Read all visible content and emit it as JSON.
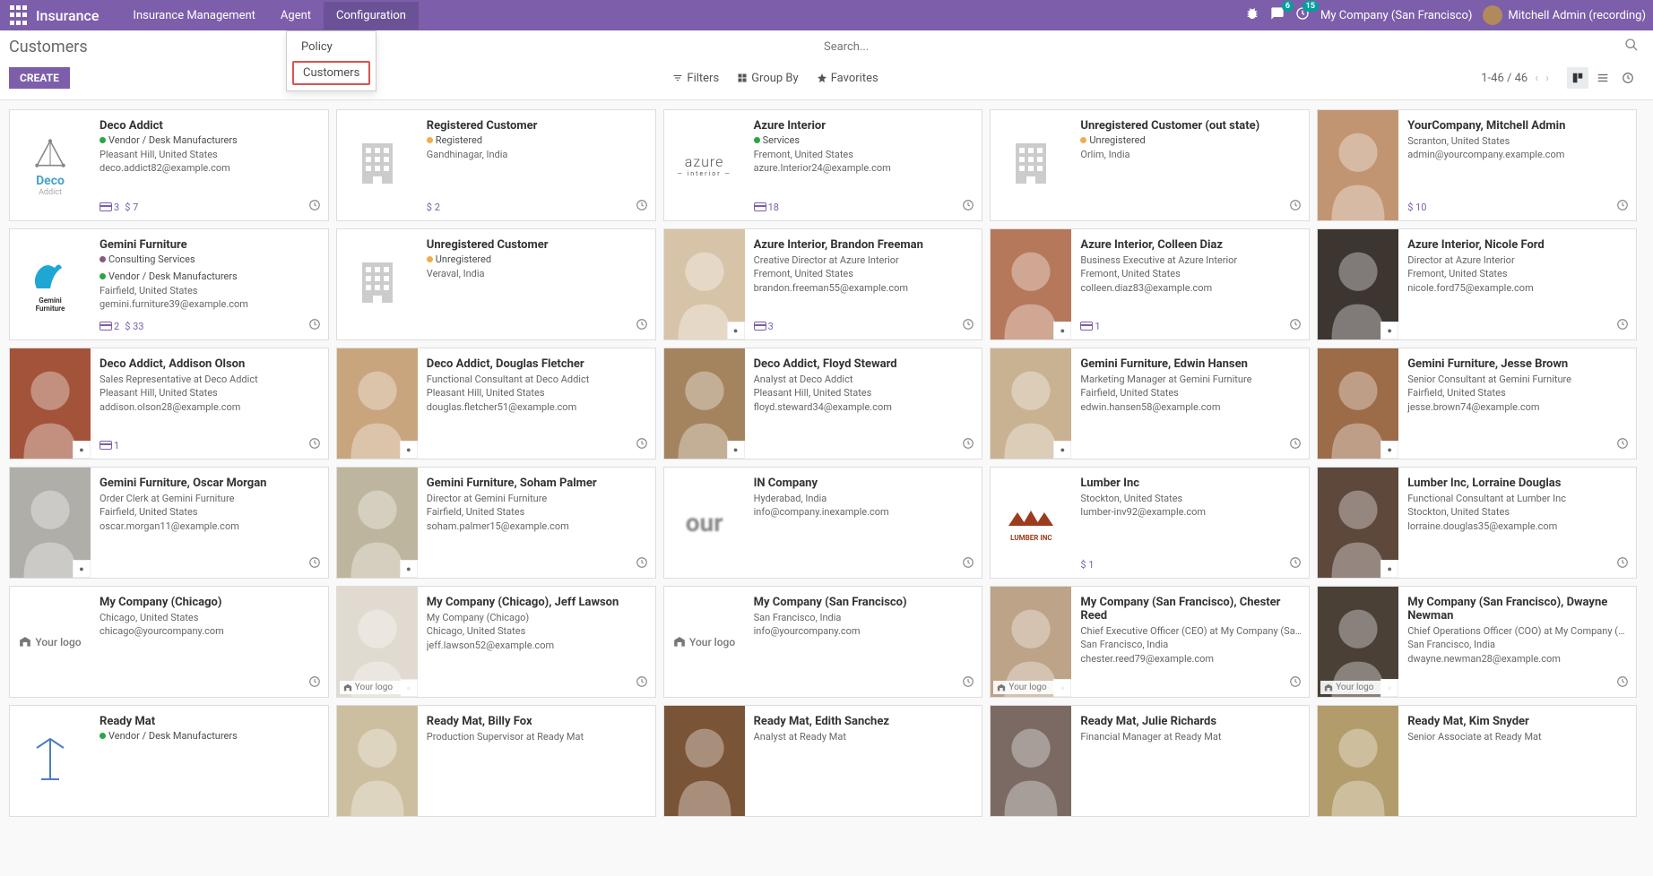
{
  "navbar": {
    "brand": "Insurance",
    "items": [
      "Insurance Management",
      "Agent",
      "Configuration"
    ],
    "msg_badge": "6",
    "clock_badge": "15",
    "company": "My Company (San Francisco)",
    "user": "Mitchell Admin (recording)"
  },
  "dropdown": {
    "policy": "Policy",
    "customers": "Customers"
  },
  "cp": {
    "title": "Customers",
    "create": "CREATE",
    "search_placeholder": "Search...",
    "filters": "Filters",
    "groupby": "Group By",
    "favorites": "Favorites",
    "pager": "1-46 / 46"
  },
  "cards": [
    {
      "name": "Deco Addict",
      "tags": [
        {
          "c": "#28a745",
          "t": "Vendor / Desk Manufacturers"
        }
      ],
      "lines": [
        "Pleasant Hill, United States",
        "deco.addict82@example.com"
      ],
      "footer": {
        "cc": "3",
        "amt": "$ 7",
        "clock": true
      },
      "avatar": "deco"
    },
    {
      "name": "Registered Customer",
      "tags": [
        {
          "c": "#f0ad4e",
          "t": "Registered"
        }
      ],
      "lines": [
        "Gandhinagar, India"
      ],
      "footer": {
        "amt": "$ 2",
        "clock": true
      },
      "avatar": "building"
    },
    {
      "name": "Azure Interior",
      "tags": [
        {
          "c": "#28a745",
          "t": "Services"
        }
      ],
      "lines": [
        "Fremont, United States",
        "azure.Interior24@example.com"
      ],
      "footer": {
        "cc": "18",
        "clock": true
      },
      "avatar": "azure"
    },
    {
      "name": "Unregistered Customer (out state)",
      "tags": [
        {
          "c": "#f0ad4e",
          "t": "Unregistered"
        }
      ],
      "lines": [
        "Orlim, India"
      ],
      "footer": {
        "clock": true
      },
      "avatar": "building"
    },
    {
      "name": "YourCompany, Mitchell Admin",
      "tags": [],
      "lines": [
        "Scranton, United States",
        "admin@yourcompany.example.com"
      ],
      "footer": {
        "amt": "$ 10",
        "clock": true
      },
      "avatar": "person",
      "bg": "#c19572"
    },
    {
      "name": "Gemini Furniture",
      "tags": [
        {
          "c": "#875A7B",
          "t": "Consulting Services"
        },
        {
          "c": "#28a745",
          "t": "Vendor / Desk Manufacturers"
        }
      ],
      "lines": [
        "Fairfield, United States",
        "gemini.furniture39@example.com"
      ],
      "footer": {
        "cc": "2",
        "amt": "$ 33",
        "clock": true
      },
      "avatar": "gemini"
    },
    {
      "name": "Unregistered Customer",
      "tags": [
        {
          "c": "#f0ad4e",
          "t": "Unregistered"
        }
      ],
      "lines": [
        "Veraval, India"
      ],
      "footer": {
        "clock": true
      },
      "avatar": "building"
    },
    {
      "name": "Azure Interior, Brandon Freeman",
      "tags": [],
      "lines": [
        "Creative Director at Azure Interior",
        "Fremont, United States",
        "brandon.freeman55@example.com"
      ],
      "footer": {
        "cc": "3",
        "clock": true,
        "corner": "azure"
      },
      "avatar": "person",
      "bg": "#d7c4a8"
    },
    {
      "name": "Azure Interior, Colleen Diaz",
      "tags": [],
      "lines": [
        "Business Executive at Azure Interior",
        "Fremont, United States",
        "colleen.diaz83@example.com"
      ],
      "footer": {
        "cc": "1",
        "clock": true,
        "corner": "azure"
      },
      "avatar": "person",
      "bg": "#b5785a"
    },
    {
      "name": "Azure Interior, Nicole Ford",
      "tags": [],
      "lines": [
        "Director at Azure Interior",
        "Fremont, United States",
        "nicole.ford75@example.com"
      ],
      "footer": {
        "clock": true,
        "corner": "azure"
      },
      "avatar": "person",
      "bg": "#3d3530"
    },
    {
      "name": "Deco Addict, Addison Olson",
      "tags": [],
      "lines": [
        "Sales Representative at Deco Addict",
        "Pleasant Hill, United States",
        "addison.olson28@example.com"
      ],
      "footer": {
        "cc": "1",
        "clock": true,
        "corner": "deco"
      },
      "avatar": "person",
      "bg": "#a4533b"
    },
    {
      "name": "Deco Addict, Douglas Fletcher",
      "tags": [],
      "lines": [
        "Functional Consultant at Deco Addict",
        "Pleasant Hill, United States",
        "douglas.fletcher51@example.com"
      ],
      "footer": {
        "clock": true,
        "corner": "deco"
      },
      "avatar": "person",
      "bg": "#c9a57e"
    },
    {
      "name": "Deco Addict, Floyd Steward",
      "tags": [],
      "lines": [
        "Analyst at Deco Addict",
        "Pleasant Hill, United States",
        "floyd.steward34@example.com"
      ],
      "footer": {
        "clock": true,
        "corner": "deco"
      },
      "avatar": "person",
      "bg": "#a4845e"
    },
    {
      "name": "Gemini Furniture, Edwin Hansen",
      "tags": [],
      "lines": [
        "Marketing Manager at Gemini Furniture",
        "Fairfield, United States",
        "edwin.hansen58@example.com"
      ],
      "footer": {
        "clock": true,
        "corner": "gemini"
      },
      "avatar": "person",
      "bg": "#c9b292"
    },
    {
      "name": "Gemini Furniture, Jesse Brown",
      "tags": [],
      "lines": [
        "Senior Consultant at Gemini Furniture",
        "Fairfield, United States",
        "jesse.brown74@example.com"
      ],
      "footer": {
        "clock": true,
        "corner": "gemini"
      },
      "avatar": "person",
      "bg": "#9c6b47"
    },
    {
      "name": "Gemini Furniture, Oscar Morgan",
      "tags": [],
      "lines": [
        "Order Clerk at Gemini Furniture",
        "Fairfield, United States",
        "oscar.morgan11@example.com"
      ],
      "footer": {
        "clock": true,
        "corner": "gemini"
      },
      "avatar": "person",
      "bg": "#b0aea9"
    },
    {
      "name": "Gemini Furniture, Soham Palmer",
      "tags": [],
      "lines": [
        "Director at Gemini Furniture",
        "Fairfield, United States",
        "soham.palmer15@example.com"
      ],
      "footer": {
        "clock": true,
        "corner": "gemini"
      },
      "avatar": "person",
      "bg": "#bdb59d"
    },
    {
      "name": "IN Company",
      "tags": [],
      "lines": [
        "Hyderabad, India",
        "info@company.inexample.com"
      ],
      "footer": {
        "clock": true
      },
      "avatar": "textlogo",
      "logotext": "our"
    },
    {
      "name": "Lumber Inc",
      "tags": [],
      "lines": [
        "Stockton, United States",
        "lumber-inv92@example.com"
      ],
      "footer": {
        "amt": "$ 1",
        "clock": true
      },
      "avatar": "lumber"
    },
    {
      "name": "Lumber Inc, Lorraine Douglas",
      "tags": [],
      "lines": [
        "Functional Consultant at Lumber Inc",
        "Stockton, United States",
        "lorraine.douglas35@example.com"
      ],
      "footer": {
        "clock": true,
        "corner": "lumber"
      },
      "avatar": "person",
      "bg": "#5d483b"
    },
    {
      "name": "My Company (Chicago)",
      "tags": [],
      "lines": [
        "Chicago, United States",
        "chicago@yourcompany.com"
      ],
      "footer": {
        "clock": true
      },
      "avatar": "yourlogo"
    },
    {
      "name": "My Company (Chicago), Jeff Lawson",
      "tags": [],
      "lines": [
        "My Company (Chicago)",
        "Chicago, United States",
        "jeff.lawson52@example.com"
      ],
      "footer": {
        "clock": true,
        "corner": "yourlogo"
      },
      "avatar": "person",
      "bg": "#e0dad0"
    },
    {
      "name": "My Company (San Francisco)",
      "tags": [],
      "lines": [
        "San Francisco, India",
        "info@yourcompany.com"
      ],
      "footer": {
        "clock": true
      },
      "avatar": "yourlogo"
    },
    {
      "name": "My Company (San Francisco), Chester Reed",
      "tags": [],
      "lines": [
        "Chief Executive Officer (CEO) at My Company (San Francisco)",
        "San Francisco, India",
        "chester.reed79@example.com"
      ],
      "footer": {
        "clock": true,
        "corner": "yourlogo"
      },
      "avatar": "person",
      "bg": "#bda388"
    },
    {
      "name": "My Company (San Francisco), Dwayne Newman",
      "tags": [],
      "lines": [
        "Chief Operations Officer (COO) at My Company (San Francisco)",
        "San Francisco, India",
        "dwayne.newman28@example.com"
      ],
      "footer": {
        "clock": true,
        "corner": "yourlogo"
      },
      "avatar": "person",
      "bg": "#4a4036"
    },
    {
      "name": "Ready Mat",
      "tags": [
        {
          "c": "#28a745",
          "t": "Vendor / Desk Manufacturers"
        }
      ],
      "lines": [],
      "footer": {},
      "avatar": "readymat"
    },
    {
      "name": "Ready Mat, Billy Fox",
      "tags": [],
      "lines": [
        "Production Supervisor at Ready Mat"
      ],
      "footer": {},
      "avatar": "person",
      "bg": "#ccbfa0"
    },
    {
      "name": "Ready Mat, Edith Sanchez",
      "tags": [],
      "lines": [
        "Analyst at Ready Mat"
      ],
      "footer": {},
      "avatar": "person",
      "bg": "#7a5436"
    },
    {
      "name": "Ready Mat, Julie Richards",
      "tags": [],
      "lines": [
        "Financial Manager at Ready Mat"
      ],
      "footer": {},
      "avatar": "person",
      "bg": "#7a6a63"
    },
    {
      "name": "Ready Mat, Kim Snyder",
      "tags": [],
      "lines": [
        "Senior Associate at Ready Mat"
      ],
      "footer": {},
      "avatar": "person",
      "bg": "#b29c6b"
    }
  ]
}
